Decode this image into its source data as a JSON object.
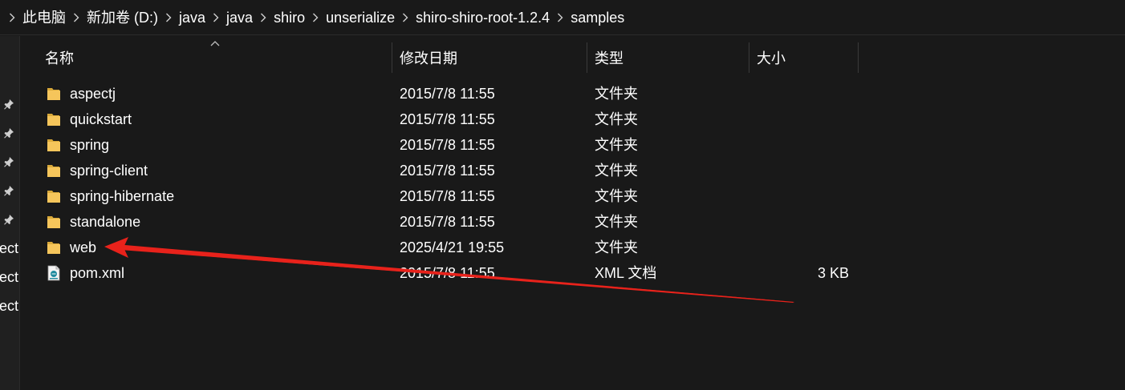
{
  "breadcrumb": {
    "items": [
      "此电脑",
      "新加卷 (D:)",
      "java",
      "java",
      "shiro",
      "unserialize",
      "shiro-shiro-root-1.2.4",
      "samples"
    ]
  },
  "navpane": {
    "partial_items": [
      "ect",
      "ect",
      "ect"
    ]
  },
  "columns": {
    "name": "名称",
    "date": "修改日期",
    "type": "类型",
    "size": "大小"
  },
  "files": [
    {
      "name": "aspectj",
      "date": "2015/7/8 11:55",
      "type": "文件夹",
      "size": "",
      "icon": "folder-icon"
    },
    {
      "name": "quickstart",
      "date": "2015/7/8 11:55",
      "type": "文件夹",
      "size": "",
      "icon": "folder-icon"
    },
    {
      "name": "spring",
      "date": "2015/7/8 11:55",
      "type": "文件夹",
      "size": "",
      "icon": "folder-icon"
    },
    {
      "name": "spring-client",
      "date": "2015/7/8 11:55",
      "type": "文件夹",
      "size": "",
      "icon": "folder-icon"
    },
    {
      "name": "spring-hibernate",
      "date": "2015/7/8 11:55",
      "type": "文件夹",
      "size": "",
      "icon": "folder-icon"
    },
    {
      "name": "standalone",
      "date": "2015/7/8 11:55",
      "type": "文件夹",
      "size": "",
      "icon": "folder-icon"
    },
    {
      "name": "web",
      "date": "2025/4/21 19:55",
      "type": "文件夹",
      "size": "",
      "icon": "folder-icon"
    },
    {
      "name": "pom.xml",
      "date": "2015/7/8 11:55",
      "type": "XML 文档",
      "size": "3 KB",
      "icon": "xml-file-icon"
    }
  ],
  "colors": {
    "background": "#191919",
    "text": "#ffffff",
    "folder": "#f5c55b",
    "annotation_arrow": "#e8221b"
  }
}
